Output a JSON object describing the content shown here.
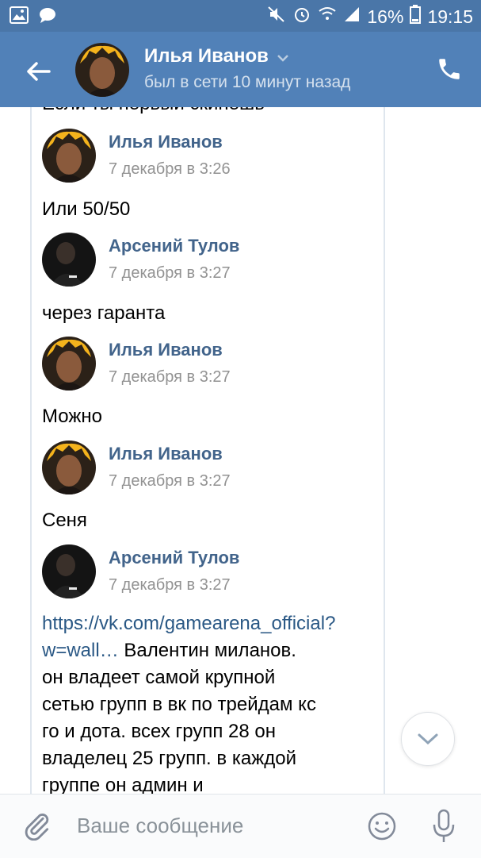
{
  "statusbar": {
    "battery": "16%",
    "time": "19:15"
  },
  "header": {
    "name": "Илья Иванов",
    "status": "был в сети 10 минут назад"
  },
  "thread": {
    "cut_text": "Если ты первый скинешь",
    "messages": [
      {
        "name": "Илья Иванов",
        "time": "7 декабря в 3:26",
        "text": "Или 50/50"
      },
      {
        "name": "Арсений Тулов",
        "time": "7 декабря в 3:27",
        "text": "через гаранта"
      },
      {
        "name": "Илья Иванов",
        "time": "7 декабря в 3:27",
        "text": "Можно"
      },
      {
        "name": "Илья Иванов",
        "time": "7 декабря в 3:27",
        "text": "Сеня"
      },
      {
        "name": "Арсений Тулов",
        "time": "7 декабря в 3:27",
        "link": "https://vk.com/gamearena_official?w=wall…",
        "text": " Валентин миланов. он владеет самой крупной сетью групп в вк по трейдам кс го и дота. всех групп 28 он владелец 25 групп. в каждой группе он админ и"
      }
    ]
  },
  "composer": {
    "placeholder": "Ваше сообщение"
  },
  "colors": {
    "header": "#5181b8",
    "statusbar": "#4a76a8",
    "name": "#42648b",
    "link": "#2a5885"
  }
}
